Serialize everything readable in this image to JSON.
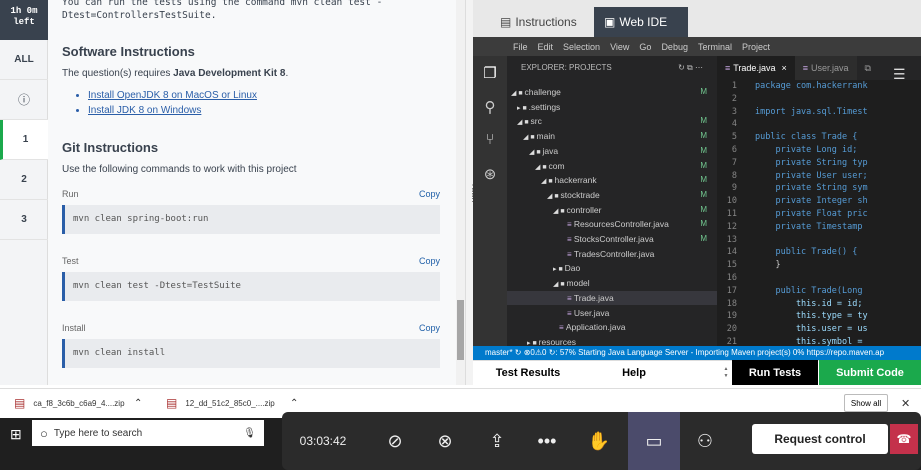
{
  "timer": {
    "line1": "1h 0m",
    "line2": "left"
  },
  "nav": {
    "all": "ALL",
    "info": "ⓘ",
    "q1": "1",
    "q2": "2",
    "q3": "3"
  },
  "instructions": {
    "intro_line1": "You can run the tests using the command mvn clean test -",
    "intro_line2": "Dtest=ControllersTestSuite.",
    "software_heading": "Software Instructions",
    "software_text_pre": "The question(s) requires ",
    "software_text_bold": "Java Development Kit 8",
    "software_text_post": ".",
    "link1": "Install OpenJDK 8 on MacOS or Linux",
    "link2": "Install JDK 8 on Windows",
    "git_heading": "Git Instructions",
    "git_text": "Use the following commands to work with this project",
    "copy_label": "Copy",
    "commands": [
      {
        "label": "Run",
        "cmd": "mvn clean spring-boot:run"
      },
      {
        "label": "Test",
        "cmd": "mvn clean test -Dtest=TestSuite"
      },
      {
        "label": "Install",
        "cmd": "mvn clean install"
      }
    ]
  },
  "ide_tabs": {
    "instructions": "Instructions",
    "webide": "Web IDE"
  },
  "menu": [
    "File",
    "Edit",
    "Selection",
    "View",
    "Go",
    "Debug",
    "Terminal",
    "Project"
  ],
  "explorer": {
    "title": "EXPLORER: PROJECTS",
    "items": [
      {
        "label": "challenge",
        "mark": "M"
      },
      {
        "label": ".settings",
        "mark": ""
      },
      {
        "label": "src",
        "mark": "M"
      },
      {
        "label": "main",
        "mark": "M"
      },
      {
        "label": "java",
        "mark": "M"
      },
      {
        "label": "com",
        "mark": "M"
      },
      {
        "label": "hackerrank",
        "mark": "M"
      },
      {
        "label": "stocktrade",
        "mark": "M"
      },
      {
        "label": "controller",
        "mark": "M"
      },
      {
        "label": "ResourcesController.java",
        "mark": "M"
      },
      {
        "label": "StocksController.java",
        "mark": "M"
      },
      {
        "label": "TradesController.java",
        "mark": ""
      },
      {
        "label": "Dao",
        "mark": ""
      },
      {
        "label": "model",
        "mark": ""
      },
      {
        "label": "Trade.java",
        "mark": ""
      },
      {
        "label": "User.java",
        "mark": ""
      },
      {
        "label": "Application.java",
        "mark": ""
      },
      {
        "label": "resources",
        "mark": ""
      }
    ]
  },
  "editor": {
    "tab_active": "Trade.java",
    "tab_close": "×",
    "tab_other": "User.java",
    "lines": [
      {
        "n": "1",
        "text": "package com.hackerrank"
      },
      {
        "n": "2",
        "text": ""
      },
      {
        "n": "3",
        "text": "import java.sql.Timest"
      },
      {
        "n": "4",
        "text": ""
      },
      {
        "n": "5",
        "text": "public class Trade {"
      },
      {
        "n": "6",
        "text": "    private Long id;"
      },
      {
        "n": "7",
        "text": "    private String typ"
      },
      {
        "n": "8",
        "text": "    private User user;"
      },
      {
        "n": "9",
        "text": "    private String sym"
      },
      {
        "n": "10",
        "text": "    private Integer sh"
      },
      {
        "n": "11",
        "text": "    private Float pric"
      },
      {
        "n": "12",
        "text": "    private Timestamp"
      },
      {
        "n": "13",
        "text": ""
      },
      {
        "n": "14",
        "text": "    public Trade() {"
      },
      {
        "n": "15",
        "text": "    }"
      },
      {
        "n": "16",
        "text": ""
      },
      {
        "n": "17",
        "text": "    public Trade(Long"
      },
      {
        "n": "18",
        "text": "        this.id = id;"
      },
      {
        "n": "19",
        "text": "        this.type = ty"
      },
      {
        "n": "20",
        "text": "        this.user = us"
      },
      {
        "n": "21",
        "text": "        this.symbol ="
      }
    ]
  },
  "statusbar": "master*  ↻  ⊗0⚠0  ↻: 57% Starting Java Language Server - Importing Maven project(s) 0% https://repo.maven.ap",
  "bottom": {
    "test_results": "Test Results",
    "help": "Help",
    "run_tests": "Run Tests",
    "submit": "Submit Code"
  },
  "downloads": {
    "file1": "ca_f8_3c6b_c6a9_4....zip",
    "file2": "12_dd_51c2_85c0_....zip",
    "show_all": "Show all",
    "close": "✕"
  },
  "taskbar": {
    "search_placeholder": "Type here to search"
  },
  "meeting": {
    "time": "03:03:42",
    "request_control": "Request control"
  },
  "colors": {
    "accent_green": "#1ba94c",
    "submit_bg": "#1ba94c",
    "vscode_blue": "#007acc"
  }
}
